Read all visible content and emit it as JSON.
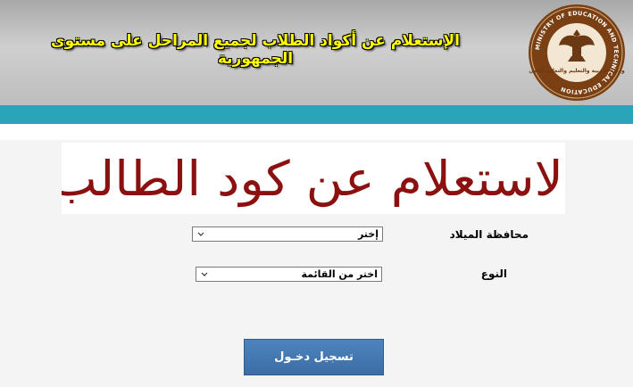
{
  "header": {
    "title": "الإستعلام عن أكواد الطلاب لجميع المراحل على مستوى الجمهورية",
    "logo": {
      "top_text": "MINISTRY OF EDUCATION AND TECHNICAL EDUCATION",
      "arabic_text": "وزارة التربية والتعليم والتعليم الفني"
    }
  },
  "banner": {
    "text": "الاستعلام عن كود الطالب"
  },
  "form": {
    "governorate": {
      "label": "محافظة الميلاد",
      "selected": "إختر"
    },
    "gender": {
      "label": "النوع",
      "selected": "اختر من القائمة"
    },
    "submit_label": "تسجيل دخـول"
  },
  "colors": {
    "header_title": "#ffff00",
    "teal_bar": "#2aa4b8",
    "banner_text": "#8b1111",
    "button": "#4f83bd"
  }
}
